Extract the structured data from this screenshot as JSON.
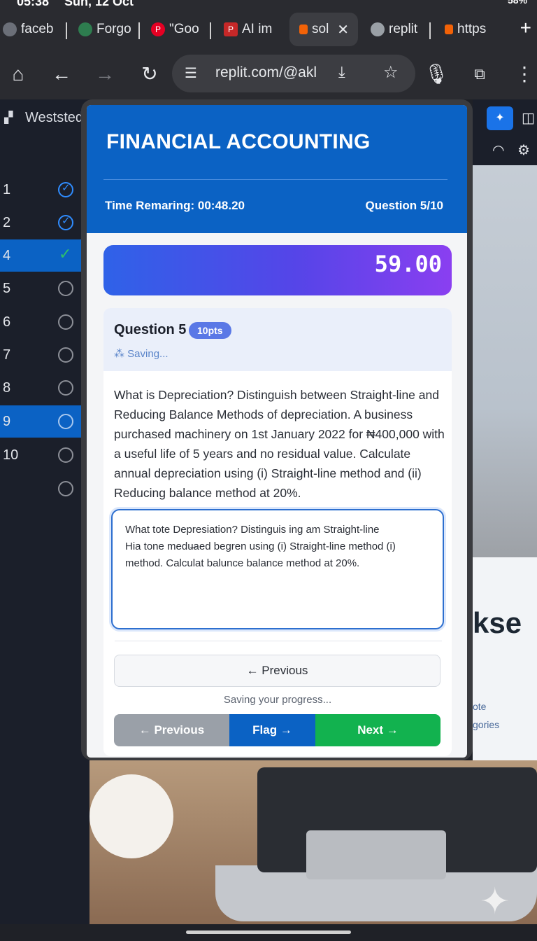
{
  "status_bar": {
    "time": "05:38",
    "date": "Sun, 12 Oct",
    "battery": "58%"
  },
  "tabs": [
    {
      "label": "faceb",
      "icon": "globe-icon",
      "color": "#6b6f78"
    },
    {
      "label": "Forgo",
      "icon": "shield-icon",
      "color": "#2e7d4f"
    },
    {
      "label": "\"Goo",
      "icon": "pinterest-icon",
      "color": "#e60023"
    },
    {
      "label": "AI im",
      "icon": "doc-icon",
      "color": "#c62828"
    },
    {
      "label": "sol",
      "icon": "replit-icon",
      "color": "#f26207"
    },
    {
      "label": "replit",
      "icon": "globe-icon",
      "color": "#9aa0a6"
    },
    {
      "label": "https",
      "icon": "replit-icon",
      "color": "#f26207"
    }
  ],
  "toolbar": {
    "url": "replit.com/@akl"
  },
  "sidebar": {
    "title": "Weststed",
    "rows": [
      {
        "num": "1",
        "status": "done",
        "highlight": false
      },
      {
        "num": "2",
        "status": "done",
        "highlight": false
      },
      {
        "num": "4",
        "status": "check",
        "highlight": true
      },
      {
        "num": "5",
        "status": "empty",
        "highlight": false
      },
      {
        "num": "6",
        "status": "empty",
        "highlight": false
      },
      {
        "num": "7",
        "status": "empty",
        "highlight": false
      },
      {
        "num": "8",
        "status": "empty",
        "highlight": false
      },
      {
        "num": "9",
        "status": "empty",
        "highlight": true
      },
      {
        "num": "10",
        "status": "empty",
        "highlight": false
      },
      {
        "num": "",
        "status": "empty",
        "highlight": false
      }
    ]
  },
  "background": {
    "laptop_word": "kse",
    "laptop_line1": "ote",
    "laptop_line2": "gories"
  },
  "exam": {
    "title": "FINANCIAL ACCOUNTING",
    "timer": "Time Remaring: 00:48.20",
    "question_count": "Question 5/10",
    "score": "59.00",
    "question_label": "Question 5",
    "points": "10pts",
    "saving_status": "Saving...",
    "question_text": "What is Depreciation? Distinguish between Straight-line and Reducing Balance Methods of depreciation. A business purchased machinery on 1st January 2022 for ₦400,000 with a useful life of 5 years and no residual value. Calculate annual depreciation using (i) Straight-line method and (ii) Reducing balance method at 20%.",
    "answer_text": "What tote Depresiation? Distinguis ing am Straight-line\nHia tone medu̶aed begren using (i) Straight-line method (i)\nmethod. Calculat balunce balance method at 20%.",
    "prev_wide_label": "← Previous",
    "progress_msg": "Saving your progress...",
    "prev_label": "← Previous",
    "flag_label": "Flag →",
    "next_label": "Next →"
  },
  "colors": {
    "header": "#0b62c4",
    "next": "#12b24f",
    "flag": "#0b62c4",
    "prev": "#9aa0a8"
  }
}
